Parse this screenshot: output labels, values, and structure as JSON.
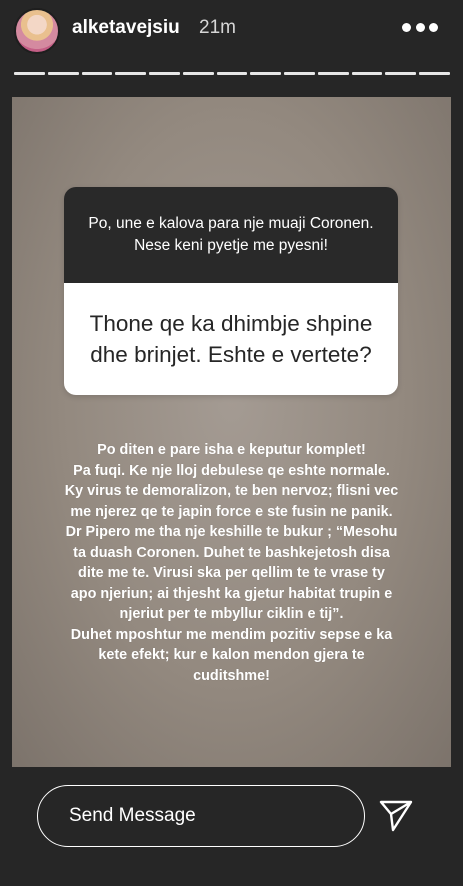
{
  "header": {
    "username": "alketavejsiu",
    "time": "21m",
    "more_icon": "ellipsis-icon",
    "progress_segments": 13
  },
  "story": {
    "question_prompt": "Po, une e kalova para nje muaji Coronen. Nese keni pyetje me pyesni!",
    "question_text": "Thone qe ka dhimbje shpine dhe brinjet. Eshte e vertete?",
    "answer_text": "Po diten e pare isha e keputur komplet!\nPa fuqi. Ke nje lloj debulese qe eshte normale.\nKy virus te demoralizon, te ben nervoz; flisni vec\nme njerez qe te japin force e ste fusin ne panik.\nDr Pipero me tha nje keshille te bukur ; “Mesohu\nta duash Coronen. Duhet te bashkejetosh disa\ndite me te. Virusi ska per qellim te te vrase ty\napo njeriun; ai thjesht ka gjetur habitat trupin e\nnjeriut per te mbyllur ciklin e tij”.\nDuhet mposhtur me mendim pozitiv sepse e ka\nkete efekt; kur e kalon mendon gjera te\ncuditshme!"
  },
  "footer": {
    "message_placeholder": "Send Message",
    "send_icon": "paper-plane-icon"
  }
}
